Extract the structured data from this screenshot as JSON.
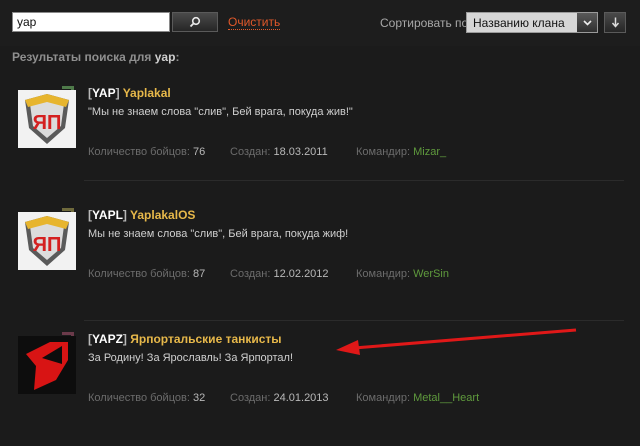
{
  "search": {
    "query": "yap",
    "clear_label": "Очистить"
  },
  "sort": {
    "label": "Сортировать по:",
    "selected": "Названию клана"
  },
  "results": {
    "heading_prefix": "Результаты поиска для",
    "query": "yap",
    "heading_suffix": ":"
  },
  "labels": {
    "members": "Количество бойцов:",
    "created": "Создан:",
    "commander": "Командир:"
  },
  "clans": [
    {
      "tag": "YAP",
      "name": "Yaplakal",
      "motto": "\"Мы не знаем слова \"слив\", Бей врага, покуда жив!\"",
      "members": "76",
      "created": "18.03.2011",
      "commander": "Mizar_",
      "corner_color": "#4f7b4a"
    },
    {
      "tag": "YAPL",
      "name": "YaplakalOS",
      "motto": "Мы не знаем слова \"слив\", Бей врага, покуда жиф!",
      "members": "87",
      "created": "12.02.2012",
      "commander": "WerSin",
      "corner_color": "#6f6a3c"
    },
    {
      "tag": "YAPZ",
      "name": "Ярпортальские танкисты",
      "motto": "За Родину! За Ярославль! За Ярпортал!",
      "members": "32",
      "created": "24.01.2013",
      "commander": "Metal__Heart",
      "corner_color": "#6b3a4a"
    }
  ],
  "colors": {
    "accent_orange": "#e2592a",
    "clan_name": "#e7b84a",
    "commander": "#5f9a3d",
    "annotation_arrow": "#e01818"
  },
  "icons": {
    "search": "magnifier-icon",
    "dropdown": "chevron-down-icon",
    "sort_direction": "arrow-down-icon"
  }
}
